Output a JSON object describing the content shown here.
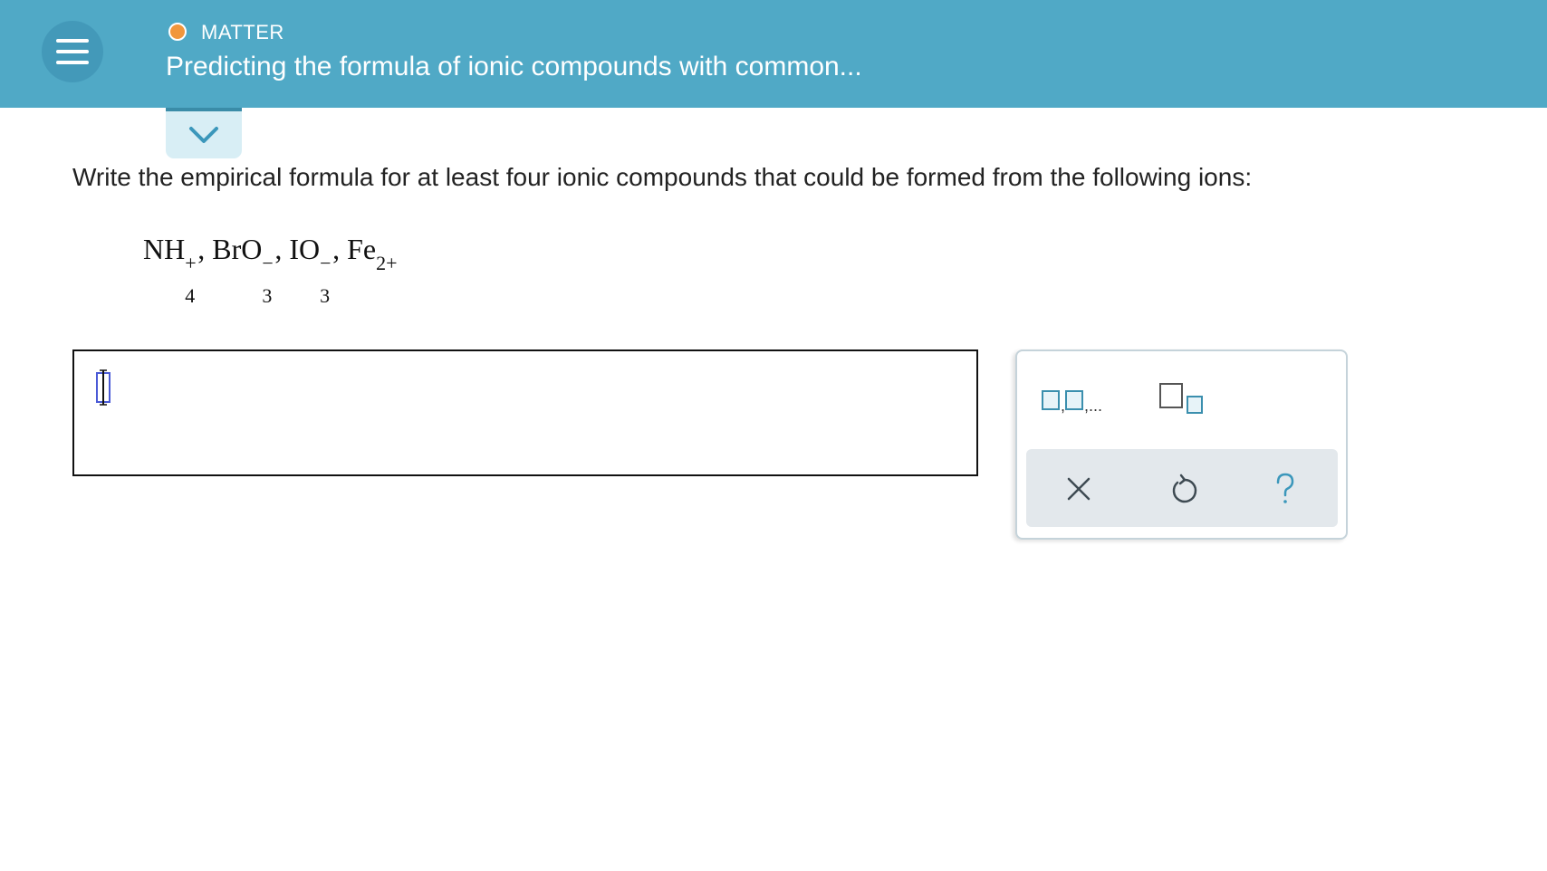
{
  "header": {
    "category": "MATTER",
    "title": "Predicting the formula of ionic compounds with common...",
    "status_color": "#f1963c",
    "background_color": "#50a9c6"
  },
  "question": {
    "prompt": "Write the empirical formula for at least four ionic compounds that could be formed from the following ions:",
    "ions": [
      {
        "base": "NH",
        "subscript": "4",
        "charge": "+"
      },
      {
        "base": "BrO",
        "subscript": "3",
        "charge": "−"
      },
      {
        "base": "IO",
        "subscript": "3",
        "charge": "−"
      },
      {
        "base": "Fe",
        "subscript": "",
        "charge": "2+"
      }
    ],
    "separator": ","
  },
  "answer": {
    "value": ""
  },
  "toolbar": {
    "list_label": "□,□,...",
    "superscript_label": "□□",
    "clear_label": "×",
    "undo_label": "↺",
    "help_label": "?"
  },
  "icons": {
    "menu": "hamburger-icon",
    "expand": "chevron-down-icon",
    "cursor": "text-cursor-icon",
    "list": "comma-list-icon",
    "superscript": "superscript-box-icon",
    "clear": "close-icon",
    "undo": "undo-icon",
    "help": "question-mark-icon"
  }
}
